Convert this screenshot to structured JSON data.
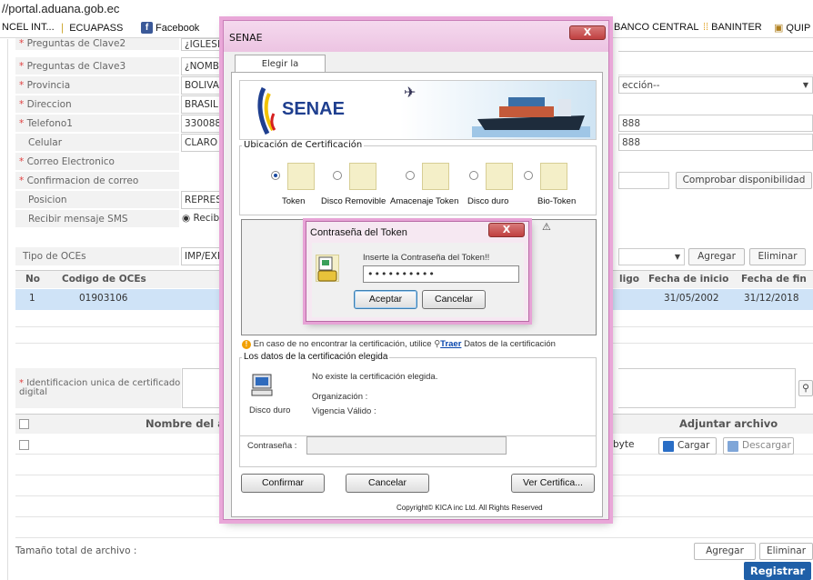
{
  "browser": {
    "url": "//portal.aduana.gob.ec",
    "bookmarks": [
      "NCEL INT...",
      "ECUAPASS",
      "Facebook",
      "BANCO CENTRAL",
      "BANINTER",
      "QUIP"
    ]
  },
  "form": {
    "fields": [
      {
        "label": "Preguntas de Clave2",
        "required": true,
        "value": "¿IGLESI"
      },
      {
        "label": "Preguntas de Clave3",
        "required": true,
        "value": "¿NOMBR"
      },
      {
        "label": "Provincia",
        "required": true,
        "value": "BOLIVA",
        "right": "ección--"
      },
      {
        "label": "Direccion",
        "required": true,
        "value": "BRASIL"
      },
      {
        "label": "Telefono1",
        "required": true,
        "value": "330088",
        "right": "888"
      },
      {
        "label": "Celular",
        "required": false,
        "value": "CLARO",
        "right": "888"
      },
      {
        "label": "Correo Electronico",
        "required": true,
        "value": ""
      },
      {
        "label": "Confirmacion de correo electronico",
        "required": true,
        "value": ""
      },
      {
        "label": "Posicion",
        "required": false,
        "value": "REPRES"
      },
      {
        "label": "Recibir mensaje SMS",
        "required": false,
        "value": "Recib"
      }
    ],
    "check_button": "Comprobar disponibilidad",
    "oce_label": "Tipo de OCEs",
    "oce_value": "IMP/EXP",
    "add": "Agregar",
    "remove": "Eliminar",
    "oce_table": {
      "headers": [
        "No",
        "Codigo de OCEs",
        "ligo",
        "Fecha de inicio",
        "Fecha de fin"
      ],
      "rows": [
        {
          "no": "1",
          "code": "01903106",
          "start": "31/05/2002",
          "end": "31/12/2018"
        }
      ]
    },
    "cert_id_label": "Identificacion unica de certificado digital",
    "files": {
      "name_header": "Nombre del ar",
      "attach_header": "Adjuntar archivo",
      "size_unit": "byte",
      "upload": "Cargar",
      "download": "Descargar"
    },
    "total_size": "Tamaño total de archivo :",
    "add2": "Agregar",
    "remove2": "Eliminar",
    "register": "Registrar"
  },
  "senae": {
    "title": "SENAE",
    "close": "X",
    "tab": "Elegir la Certificación",
    "banner": "SENAE",
    "location_legend": "Ubicación de Certificación",
    "options": [
      "Token",
      "Disco Removible",
      "Amacenaje Token",
      "Disco duro",
      "Bio-Token"
    ],
    "notice": "En caso de no encontrar la certificación, utilice",
    "notice_link": "Traer",
    "notice_tail": "Datos de la certificación",
    "data_legend": "Los datos de la certificación elegida",
    "not_exists": "No existe la certificación elegida.",
    "org": "Organización :",
    "validity": "Vigencia Válido :",
    "disk_label": "Disco duro",
    "password_label": "Contraseña :",
    "confirm": "Confirmar",
    "cancel": "Cancelar",
    "view_cert": "Ver Certifica...",
    "copyright": "Copyright© KICA inc Ltd. All Rights Reserved"
  },
  "token_dialog": {
    "title": "Contraseña del Token",
    "close": "X",
    "prompt": "Inserte la Contraseña del Token!!",
    "password": "••••••••••",
    "accept": "Aceptar",
    "cancel": "Cancelar"
  },
  "colors": {
    "accent": "#1f5fa8",
    "link": "#0645ad",
    "required": "#e04040",
    "selected_row": "#cfe3f7",
    "window_border": "#c97fb8"
  }
}
